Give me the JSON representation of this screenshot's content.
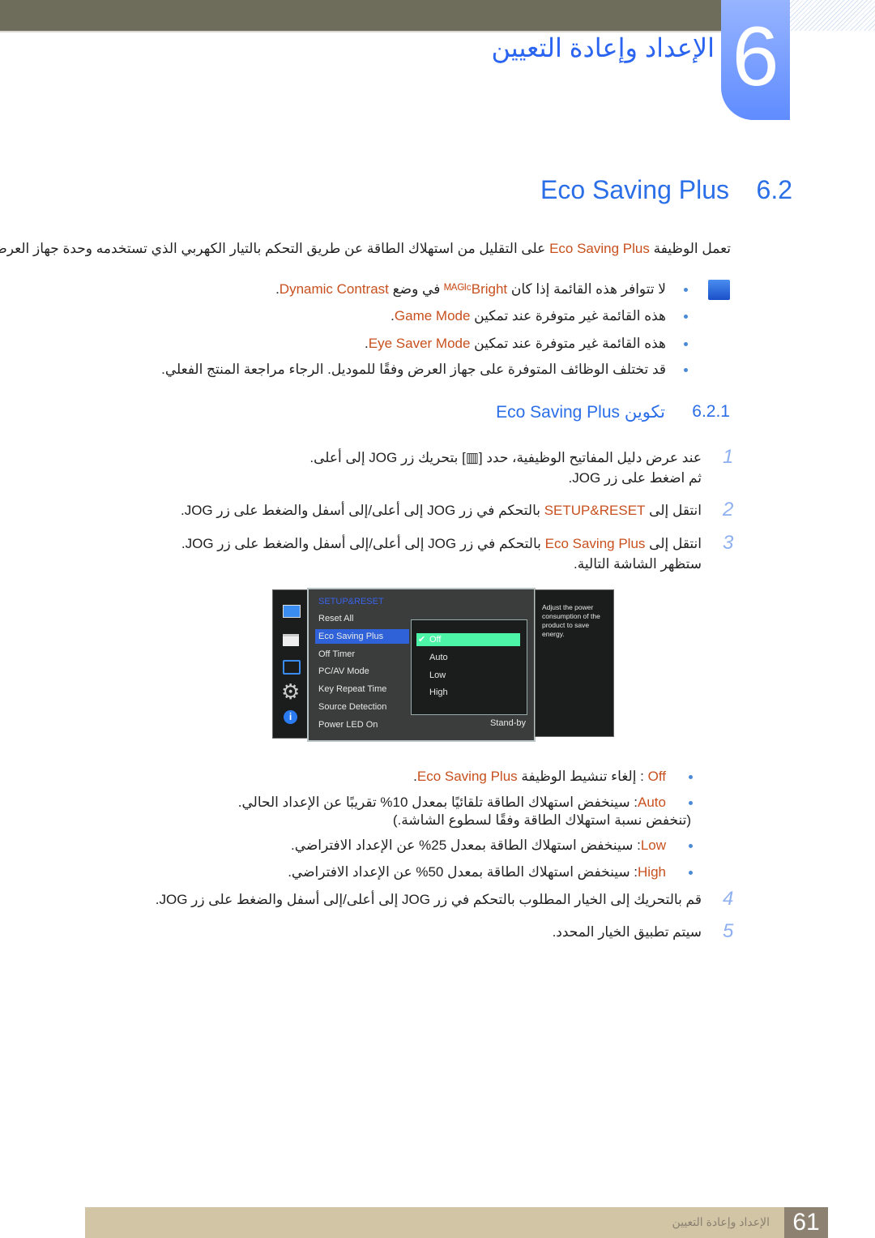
{
  "chapter": {
    "number": "6",
    "title": "الإعداد وإعادة التعيين"
  },
  "section": {
    "number": "6.2",
    "title": "Eco Saving Plus"
  },
  "intro": [
    {
      "t": "تعمل الوظيفة "
    },
    {
      "t": "Eco Saving Plus",
      "o": 1
    },
    {
      "t": " على التقليل من استهلاك الطاقة عن طريق التحكم بالتيار الكهربي الذي تستخدمه وحدة جهاز العرض."
    }
  ],
  "notes": [
    [
      {
        "t": "لا تتوافر هذه القائمة إذا كان "
      },
      {
        "t": "ᴹᴬᴳᴵᶜBright",
        "o": 1
      },
      {
        "t": " في وضع "
      },
      {
        "t": "Dynamic Contrast",
        "o": 1
      },
      {
        "t": "."
      }
    ],
    [
      {
        "t": "هذه القائمة غير متوفرة عند تمكين "
      },
      {
        "t": "Game Mode",
        "o": 1
      },
      {
        "t": "."
      }
    ],
    [
      {
        "t": "هذه القائمة غير متوفرة عند تمكين "
      },
      {
        "t": "Eye Saver Mode",
        "o": 1
      },
      {
        "t": "."
      }
    ],
    [
      {
        "t": "قد تختلف الوظائف المتوفرة على جهاز العرض وفقًا للموديل. الرجاء مراجعة المنتج الفعلي."
      }
    ]
  ],
  "subsection": {
    "number": "6.2.1",
    "title": "تكوين Eco Saving Plus"
  },
  "steps": [
    {
      "n": "1",
      "lines": [
        [
          {
            "t": "عند عرض دليل المفاتيح الوظيفية، حدد [▥] بتحريك زر JOG إلى أعلى."
          }
        ],
        [
          {
            "t": "ثم اضغط على زر JOG."
          }
        ]
      ]
    },
    {
      "n": "2",
      "lines": [
        [
          {
            "t": "انتقل إلى "
          },
          {
            "t": "SETUP&RESET",
            "o": 1
          },
          {
            "t": " بالتحكم في زر JOG إلى أعلى/إلى أسفل والضغط على زر JOG."
          }
        ]
      ]
    },
    {
      "n": "3",
      "lines": [
        [
          {
            "t": "انتقل إلى "
          },
          {
            "t": "Eco Saving Plus",
            "o": 1
          },
          {
            "t": " بالتحكم في زر JOG إلى أعلى/إلى أسفل والضغط على زر JOG."
          }
        ],
        [
          {
            "t": "ستظهر الشاشة التالية."
          }
        ]
      ]
    },
    {
      "n": "4",
      "lines": [
        [
          {
            "t": "قم بالتحريك إلى الخيار المطلوب بالتحكم في زر JOG إلى أعلى/إلى أسفل والضغط على زر JOG."
          }
        ]
      ]
    },
    {
      "n": "5",
      "lines": [
        [
          {
            "t": "سيتم تطبيق الخيار المحدد."
          }
        ]
      ]
    }
  ],
  "options": [
    [
      [
        {
          "t": "Off",
          "o": 1
        },
        {
          "t": " : إلغاء تنشيط الوظيفة "
        },
        {
          "t": "Eco Saving Plus",
          "o": 1
        },
        {
          "t": "."
        }
      ]
    ],
    [
      [
        {
          "t": "Auto",
          "o": 1
        },
        {
          "t": ": سينخفض استهلاك الطاقة تلقائيًا بمعدل 10% تقريبًا عن الإعداد الحالي."
        }
      ],
      [
        {
          "t": "(تنخفض نسبة استهلاك الطاقة وفقًا لسطوع الشاشة.)"
        }
      ]
    ],
    [
      [
        {
          "t": "Low",
          "o": 1
        },
        {
          "t": ": سينخفض استهلاك الطاقة بمعدل 25% عن الإعداد الافتراضي."
        }
      ]
    ],
    [
      [
        {
          "t": "High",
          "o": 1
        },
        {
          "t": ": سينخفض استهلاك الطاقة بمعدل 50% عن الإعداد الافتراضي."
        }
      ]
    ]
  ],
  "osd": {
    "header": "SETUP&RESET",
    "items": [
      "Reset All",
      "Eco Saving Plus",
      "Off Timer",
      "PC/AV Mode",
      "Key Repeat Time",
      "Source Detection",
      "Power LED On"
    ],
    "selected": "Eco Saving Plus",
    "power_led_value": "Stand-by",
    "submenu": [
      "Off",
      "Auto",
      "Low",
      "High"
    ],
    "submenu_selected": "Off",
    "help": "Adjust the power consumption of the product to save energy.",
    "icons": [
      "monitor-icon",
      "picture-icon",
      "resize-icon",
      "gear-icon",
      "info-icon"
    ]
  },
  "footer": {
    "page": "61",
    "chapter": "الإعداد وإعادة التعيين"
  },
  "colors": {
    "accent": "#2a6ee8",
    "highlight": "#c8501e",
    "osd_selected": "#4cf5a8"
  }
}
